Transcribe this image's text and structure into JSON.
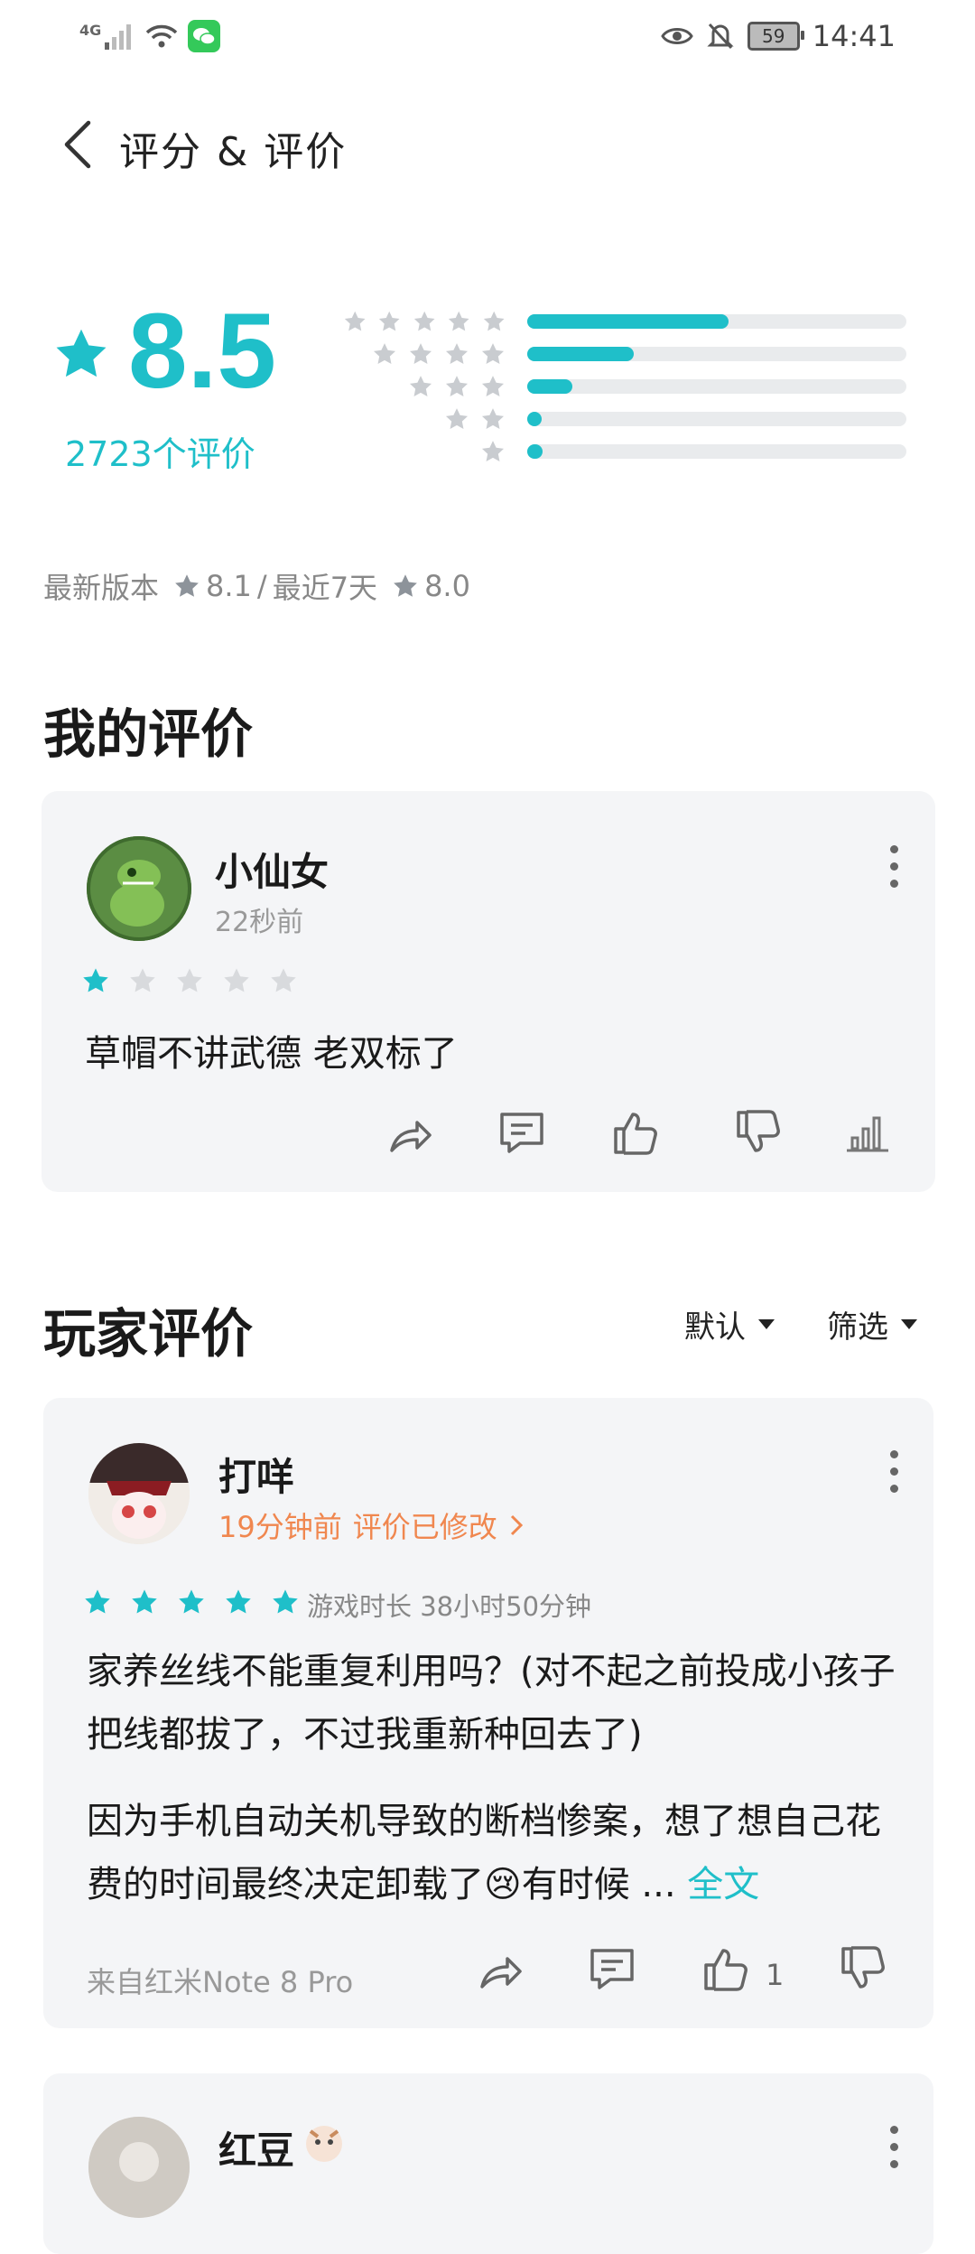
{
  "status_bar": {
    "network": "4G",
    "battery": "59",
    "time": "14:41"
  },
  "header": {
    "title": "评分 & 评价"
  },
  "summary": {
    "score": "8.5",
    "count_text": "2723个评价",
    "distribution": [
      {
        "stars": 5,
        "fraction": 0.53
      },
      {
        "stars": 4,
        "fraction": 0.28
      },
      {
        "stars": 3,
        "fraction": 0.12
      },
      {
        "stars": 2,
        "fraction": 0.03
      },
      {
        "stars": 1,
        "fraction": 0.04
      }
    ],
    "latest_label": "最新版本",
    "latest_score": "8.1",
    "separator": "/",
    "recent_label": "最近7天",
    "recent_score": "8.0"
  },
  "my_review": {
    "heading": "我的评价",
    "user": "小仙女",
    "time": "22秒前",
    "rating": 1,
    "text": "草帽不讲武德 老双标了"
  },
  "player_reviews": {
    "heading": "玩家评价",
    "sort_label": "默认",
    "filter_label": "筛选",
    "items": [
      {
        "user": "打咩",
        "time": "19分钟前",
        "edited": "评价已修改",
        "rating": 5,
        "playtime": "游戏时长 38小时50分钟",
        "para1": "家养丝线不能重复利用吗？(对不起之前投成小孩子把线都拔了，不过我重新种回去了)",
        "para2": "因为手机自动关机导致的断档惨案，想了想自己花费的时间最终决定卸载了😢有时候 ...",
        "full_text_link": "全文",
        "device": "来自红米Note 8 Pro",
        "likes": "1"
      },
      {
        "user": "红豆"
      }
    ]
  },
  "colors": {
    "accent": "#1fbfc9",
    "orange": "#f0874f",
    "card_bg": "#f4f5f7",
    "inactive_star": "#d8dadd",
    "gray_star": "#8d939a"
  },
  "icons": {
    "back": "chevron-left-icon",
    "star": "star-icon",
    "share": "share-icon",
    "comment": "comment-icon",
    "like": "thumbs-up-icon",
    "dislike": "thumbs-down-icon",
    "stats": "bar-chart-icon",
    "more": "more-vertical-icon"
  }
}
